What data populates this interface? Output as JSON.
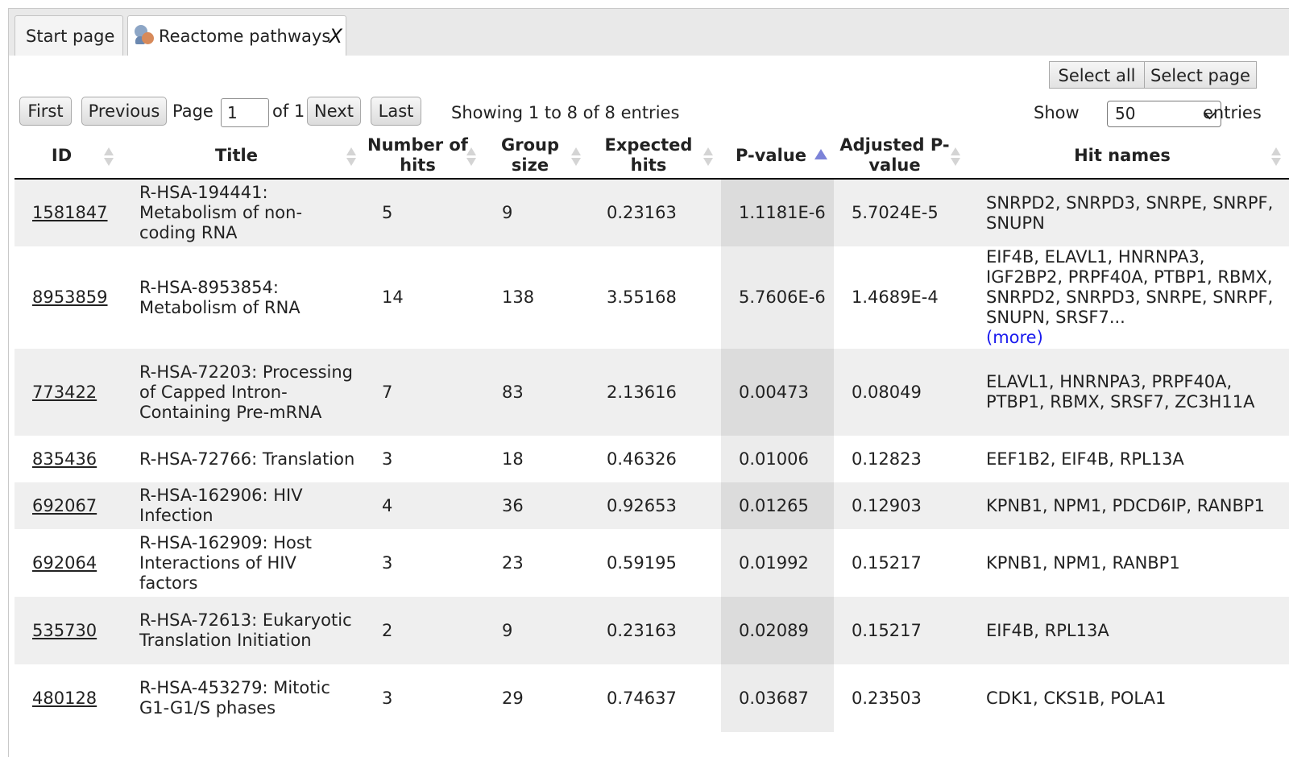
{
  "tabs": [
    {
      "label": "Start page"
    },
    {
      "label": "Reactome pathways",
      "close": "X"
    }
  ],
  "selection": {
    "select_all": "Select all",
    "select_page": "Select page"
  },
  "pager": {
    "first": "First",
    "previous": "Previous",
    "page_label": "Page",
    "page_value": "1",
    "of_label": "of 1",
    "next": "Next",
    "last": "Last",
    "info": "Showing 1 to 8 of 8 entries",
    "show_label": "Show",
    "show_value": "50",
    "entries_label": "entries"
  },
  "table": {
    "columns": [
      "ID",
      "Title",
      "Number of hits",
      "Group size",
      "Expected hits",
      "P-value",
      "Adjusted P-value",
      "Hit names"
    ],
    "sorted_column": "P-value",
    "rows": [
      {
        "id": "1581847",
        "title": "R-HSA-194441: Metabolism of non-coding RNA",
        "hits": "5",
        "group": "9",
        "expected": "0.23163",
        "p": "1.1181E-6",
        "adj": "5.7024E-5",
        "names": "SNRPD2, SNRPD3, SNRPE, SNRPF, SNUPN"
      },
      {
        "id": "8953859",
        "title": "R-HSA-8953854: Metabolism of RNA",
        "hits": "14",
        "group": "138",
        "expected": "3.55168",
        "p": "5.7606E-6",
        "adj": "1.4689E-4",
        "names": "EIF4B, ELAVL1, HNRNPA3, IGF2BP2, PRPF40A, PTBP1, RBMX, SNRPD2, SNRPD3, SNRPE, SNRPF, SNUPN, SRSF7...",
        "more": "(more)"
      },
      {
        "id": "773422",
        "title": "R-HSA-72203: Processing of Capped Intron-Containing Pre-mRNA",
        "hits": "7",
        "group": "83",
        "expected": "2.13616",
        "p": "0.00473",
        "adj": "0.08049",
        "names": "ELAVL1, HNRNPA3, PRPF40A, PTBP1, RBMX, SRSF7, ZC3H11A"
      },
      {
        "id": "835436",
        "title": "R-HSA-72766: Translation",
        "hits": "3",
        "group": "18",
        "expected": "0.46326",
        "p": "0.01006",
        "adj": "0.12823",
        "names": "EEF1B2, EIF4B, RPL13A"
      },
      {
        "id": "692067",
        "title": "R-HSA-162906: HIV Infection",
        "hits": "4",
        "group": "36",
        "expected": "0.92653",
        "p": "0.01265",
        "adj": "0.12903",
        "names": "KPNB1, NPM1, PDCD6IP, RANBP1"
      },
      {
        "id": "692064",
        "title": "R-HSA-162909: Host Interactions of HIV factors",
        "hits": "3",
        "group": "23",
        "expected": "0.59195",
        "p": "0.01992",
        "adj": "0.15217",
        "names": "KPNB1, NPM1, RANBP1"
      },
      {
        "id": "535730",
        "title": "R-HSA-72613: Eukaryotic Translation Initiation",
        "hits": "2",
        "group": "9",
        "expected": "0.23163",
        "p": "0.02089",
        "adj": "0.15217",
        "names": "EIF4B, RPL13A"
      },
      {
        "id": "480128",
        "title": "R-HSA-453279: Mitotic G1-G1/S phases",
        "hits": "3",
        "group": "29",
        "expected": "0.74637",
        "p": "0.03687",
        "adj": "0.23503",
        "names": "CDK1, CKS1B, POLA1"
      }
    ]
  }
}
